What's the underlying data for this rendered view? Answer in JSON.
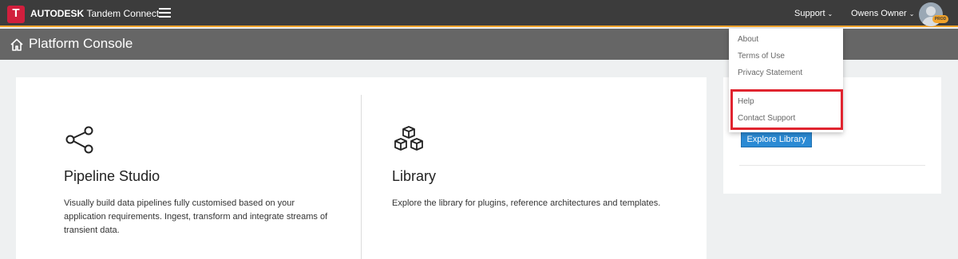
{
  "topbar": {
    "logo_letter": "T",
    "brand_company": "AUTODESK",
    "brand_product": "Tandem Connect",
    "support_label": "Support",
    "user_label": "Owens Owner",
    "env_badge": "PROD",
    "chevron": "⌄",
    "accent_color": "#f2a32a",
    "logo_color": "#d11f3d"
  },
  "titlebar": {
    "title": "Platform Console",
    "icon": "home-icon"
  },
  "tiles": [
    {
      "icon": "share-nodes-icon",
      "title": "Pipeline Studio",
      "description": "Visually build data pipelines fully customised based on your application requirements. Ingest, transform and integrate streams of transient data."
    },
    {
      "icon": "cubes-icon",
      "title": "Library",
      "description": "Explore the library for plugins, reference architectures and templates."
    }
  ],
  "side_panel": {
    "explore_button": "Explore Library",
    "button_color": "#2a8ad4"
  },
  "support_menu": {
    "items": [
      "About",
      "Terms of Use",
      "Privacy Statement",
      "Help",
      "Contact Support"
    ],
    "highlight_color": "#e0242f"
  }
}
